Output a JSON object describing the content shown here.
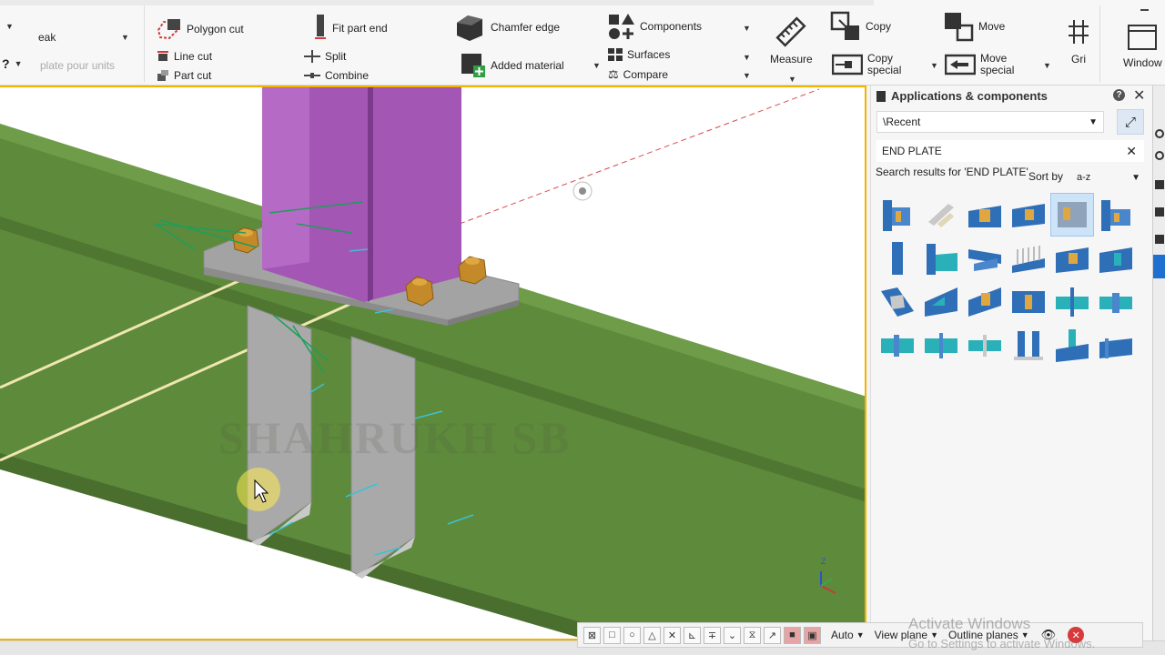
{
  "ribbon": {
    "left_labels": {
      "break": "eak",
      "template": "plate pour units"
    },
    "cut": {
      "polygon_cut": "Polygon cut",
      "line_cut": "Line cut",
      "part_cut": "Part cut"
    },
    "fit": {
      "fit_part_end": "Fit part end",
      "split": "Split",
      "combine": "Combine"
    },
    "edge": {
      "chamfer_edge": "Chamfer edge",
      "added_material": "Added material"
    },
    "components": {
      "components": "Components",
      "surfaces": "Surfaces",
      "compare": "Compare"
    },
    "measure": "Measure",
    "copy": {
      "copy": "Copy",
      "copy_special": "Copy special"
    },
    "move": {
      "move": "Move",
      "move_special": "Move special"
    },
    "grid": "Gri",
    "window": "Window"
  },
  "panel": {
    "title": "Applications & components",
    "location": "\\Recent",
    "search_value": "END PLATE",
    "results_label": "Search results for 'END PLATE'",
    "sort_label": "Sort by",
    "sort_value": "a-z"
  },
  "viewport": {
    "watermark": "SHAHRUKH SB",
    "axis_label": "Z"
  },
  "snap": {
    "auto": "Auto",
    "view_plane": "View plane",
    "outline_planes": "Outline planes"
  },
  "os": {
    "activate_title": "Activate Windows",
    "activate_sub": "Go to Settings to activate Windows."
  },
  "colors": {
    "accent_border": "#f0b400",
    "beam_green": "#5e8a3c",
    "column_purple": "#a356b4",
    "plate_grey": "#a9a9a9",
    "bolt_orange": "#c48a2a",
    "component_blue": "#2f6fb8",
    "component_teal": "#2ab0b8"
  }
}
